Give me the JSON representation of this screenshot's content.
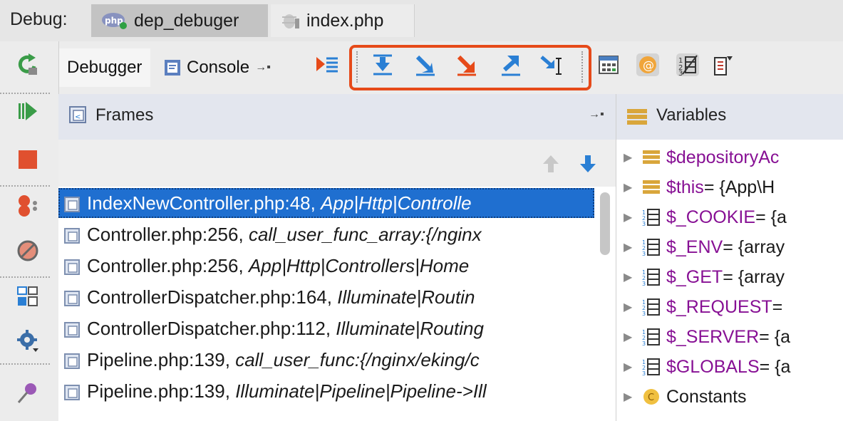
{
  "titlebar": {
    "debug_label": "Debug:",
    "tabs": [
      {
        "label": "dep_debuger",
        "icon": "php-icon"
      },
      {
        "label": "index.php",
        "icon": "bug-script-icon"
      }
    ]
  },
  "toolbar": {
    "debugger_tab": "Debugger",
    "console_tab": "Console",
    "console_pin": "→▪"
  },
  "frames": {
    "title": "Frames",
    "pin": "→▪",
    "rows": [
      {
        "file": "IndexNewController.php:48,",
        "context": "App|Http|Controlle"
      },
      {
        "file": "Controller.php:256,",
        "context": "call_user_func_array:{/nginx"
      },
      {
        "file": "Controller.php:256,",
        "context": "App|Http|Controllers|Home"
      },
      {
        "file": "ControllerDispatcher.php:164,",
        "context": "Illuminate|Routin"
      },
      {
        "file": "ControllerDispatcher.php:112,",
        "context": "Illuminate|Routing"
      },
      {
        "file": "Pipeline.php:139,",
        "context": "call_user_func:{/nginx/eking/c"
      },
      {
        "file": "Pipeline.php:139,",
        "context": "Illuminate|Pipeline|Pipeline->Ill"
      }
    ]
  },
  "variables": {
    "title": "Variables",
    "rows": [
      {
        "name": "$depositoryAc",
        "rest": "",
        "icon": "object-icon"
      },
      {
        "name": "$this",
        "rest": " = {App\\H",
        "icon": "object-icon"
      },
      {
        "name": "$_COOKIE",
        "rest": " = {a",
        "icon": "array-icon"
      },
      {
        "name": "$_ENV",
        "rest": " = {array",
        "icon": "array-icon"
      },
      {
        "name": "$_GET",
        "rest": " = {array",
        "icon": "array-icon"
      },
      {
        "name": "$_REQUEST",
        "rest": " = ",
        "icon": "array-icon"
      },
      {
        "name": "$_SERVER",
        "rest": " = {a",
        "icon": "array-icon"
      },
      {
        "name": "$GLOBALS",
        "rest": " = {a",
        "icon": "array-icon"
      },
      {
        "name": "Constants",
        "rest": "",
        "icon": "constants-icon"
      }
    ]
  },
  "colors": {
    "accent": "#e64a19",
    "selection": "#1f6fd0",
    "var_name": "#871094"
  }
}
